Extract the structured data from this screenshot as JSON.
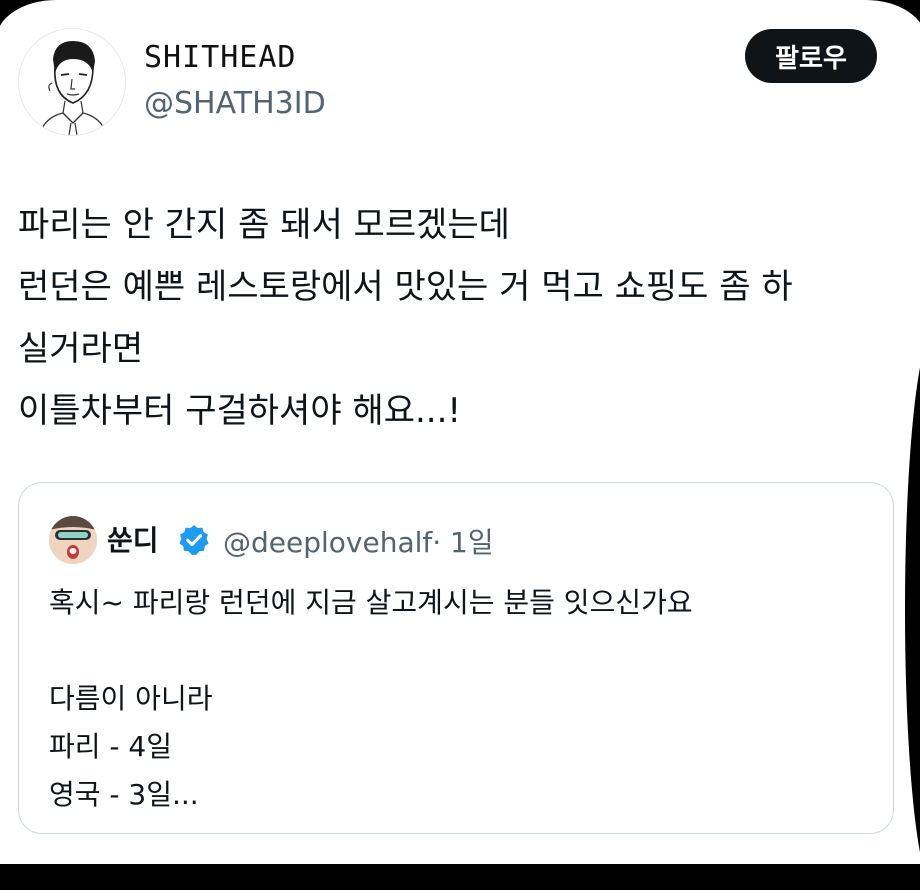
{
  "author": {
    "display_name": "SHITHEAD",
    "handle": "@SHATH3ID",
    "avatar_icon": "sketch-portrait-avatar"
  },
  "follow_button": {
    "label": "팔로우"
  },
  "tweet": {
    "lines": [
      "파리는 안 간지 좀 돼서 모르겠는데",
      "런던은 예쁜 레스토랑에서 맛있는 거 먹고 쇼핑도 좀 하",
      "실거라면",
      "이틀차부터 구걸하셔야 해요...!"
    ]
  },
  "quoted_tweet": {
    "display_name": "쑨디",
    "verified_icon": "verified-badge-icon",
    "handle": "@deeplovehalf",
    "time": "· 1일",
    "lines": [
      "혹시~ 파리랑 런던에 지금 살고계시는 분들 잇으신가요",
      "",
      "다름이 아니라",
      "파리 - 4일",
      "영국 - 3일..."
    ]
  },
  "colors": {
    "background": "#ffffff",
    "text": "#0f1419",
    "secondary_text": "#536471",
    "button_bg": "#0f1419",
    "verified": "#1d9bf0",
    "border": "#cfd9de"
  }
}
